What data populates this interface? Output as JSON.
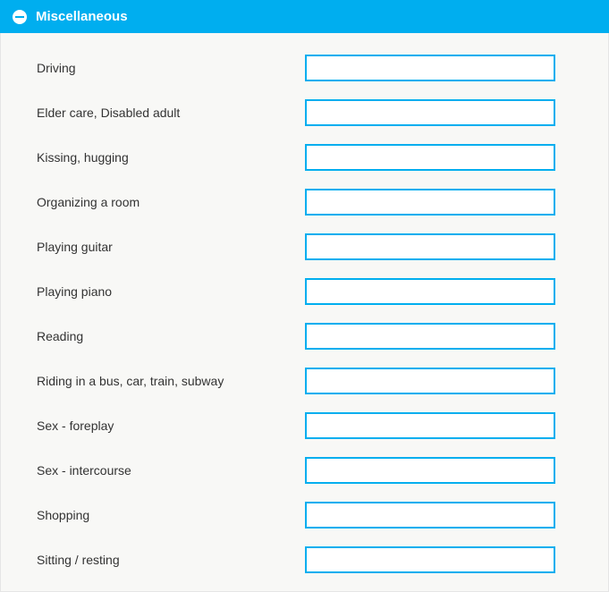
{
  "panel": {
    "title": "Miscellaneous"
  },
  "fields": [
    {
      "label": "Driving",
      "value": ""
    },
    {
      "label": "Elder care, Disabled adult",
      "value": ""
    },
    {
      "label": "Kissing, hugging",
      "value": ""
    },
    {
      "label": "Organizing a room",
      "value": ""
    },
    {
      "label": "Playing guitar",
      "value": ""
    },
    {
      "label": "Playing piano",
      "value": ""
    },
    {
      "label": "Reading",
      "value": ""
    },
    {
      "label": "Riding in a bus, car, train, subway",
      "value": ""
    },
    {
      "label": "Sex - foreplay",
      "value": ""
    },
    {
      "label": "Sex - intercourse",
      "value": ""
    },
    {
      "label": "Shopping",
      "value": ""
    },
    {
      "label": "Sitting / resting",
      "value": ""
    }
  ]
}
